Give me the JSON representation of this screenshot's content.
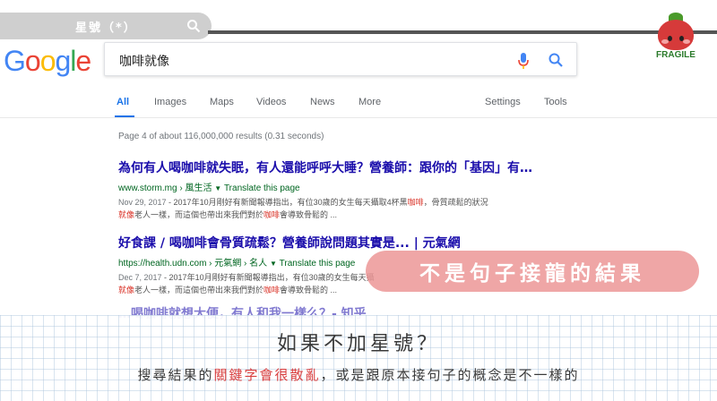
{
  "overlay_title": {
    "text": "星號（*）"
  },
  "google": {
    "logo_letters": [
      {
        "ch": "G",
        "color": "#4285F4"
      },
      {
        "ch": "o",
        "color": "#EA4335"
      },
      {
        "ch": "o",
        "color": "#FBBC05"
      },
      {
        "ch": "g",
        "color": "#4285F4"
      },
      {
        "ch": "l",
        "color": "#34A853"
      },
      {
        "ch": "e",
        "color": "#EA4335"
      }
    ],
    "query": "咖啡就像",
    "tabs": [
      "All",
      "Images",
      "Maps",
      "Videos",
      "News",
      "More"
    ],
    "tools": [
      "Settings",
      "Tools"
    ],
    "stats": "Page 4 of about 116,000,000 results (0.31 seconds)",
    "results": [
      {
        "title": "為何有人喝咖啡就失眠，有人還能呼呼大睡？營養師：跟你的「基因」有…",
        "url": "www.storm.mg › 風生活",
        "translate": "Translate this page",
        "date": "Nov 29, 2017",
        "snippet1": " - 2017年10月剛好有新聞報導指出，有位30歲的女生每天攝取4杯黑",
        "snippet1_hl": "咖啡",
        "snippet1_tail": "，骨質疏鬆的狀況",
        "snippet2_hl": "就像",
        "snippet2": "老人一樣，而這個也帶出來我們對於",
        "snippet2_hl2": "咖啡",
        "snippet2_tail": "會導致骨鬆的 ..."
      },
      {
        "title": "好食課 / 喝咖啡會骨質疏鬆？營養師說問題其實是... | 元氣網",
        "url": "https://health.udn.com › 元氣網 › 名人",
        "translate": "Translate this page",
        "date": "Dec 7, 2017",
        "snippet1": " - 2017年10月剛好有新聞報導指出，有位30歲的女生每天攝",
        "snippet1_hl": "",
        "snippet1_tail": "",
        "snippet2_hl": "就像",
        "snippet2": "老人一樣，而這個也帶出來我們對於",
        "snippet2_hl2": "咖啡",
        "snippet2_tail": "會導致骨鬆的 ..."
      }
    ],
    "ghost_title": "…喝咖啡就想大便，有人和我一樣么？- 知乎"
  },
  "mascot": {
    "label": "FRAGILE"
  },
  "bubble": {
    "text": "不是句子接龍的結果"
  },
  "caption": {
    "line1": "如果不加星號？",
    "line2_pre": "搜尋結果的",
    "line2_emph": "關鍵字會很散亂",
    "line2_post": "，或是跟原本接句子的概念是不一樣的"
  }
}
